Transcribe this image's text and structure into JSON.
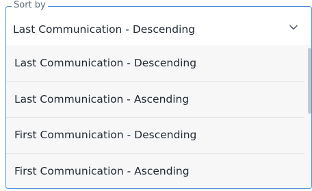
{
  "sort_select": {
    "legend": "Sort by",
    "selected_value": "Last Communication - Descending",
    "chevron_icon": "chevron-down-icon",
    "accent_color": "#4a90d9"
  },
  "sort_menu": {
    "options": [
      {
        "label": "Last Communication - Descending"
      },
      {
        "label": "Last Communication - Ascending"
      },
      {
        "label": "First Communication - Descending"
      },
      {
        "label": "First Communication - Ascending"
      }
    ]
  }
}
